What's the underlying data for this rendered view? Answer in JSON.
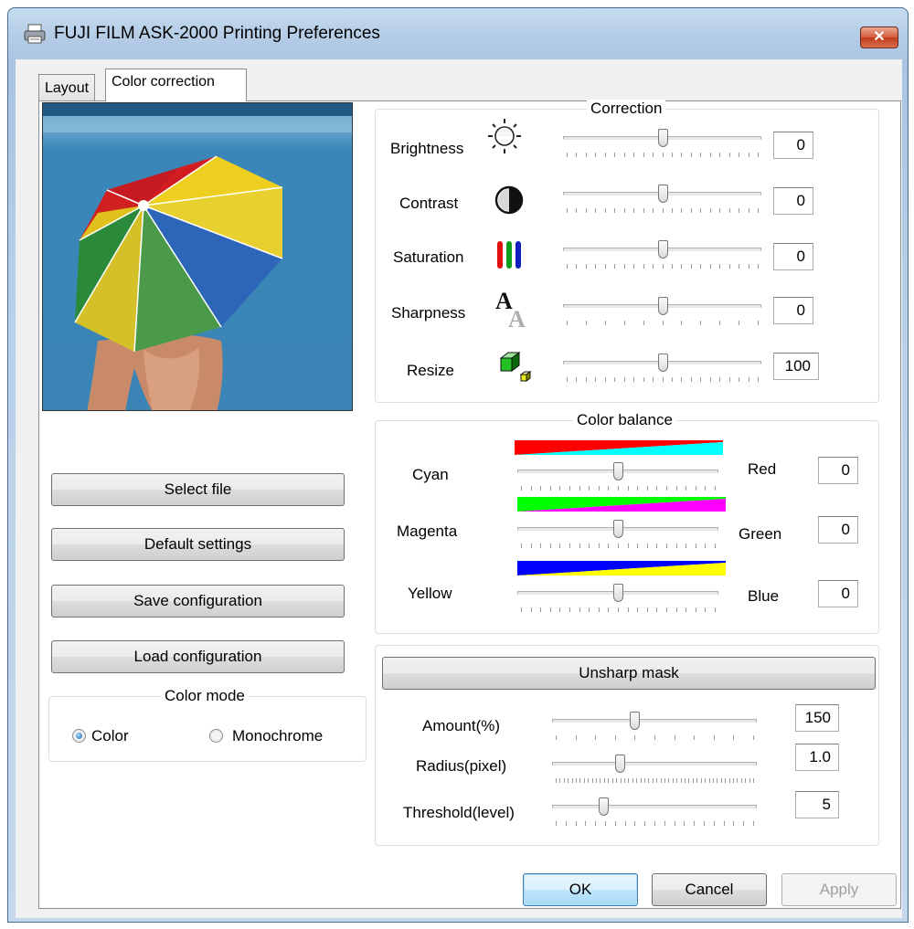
{
  "window": {
    "title": "FUJI FILM ASK-2000 Printing Preferences",
    "close_label": "✕"
  },
  "tabs": [
    {
      "label": "Layout",
      "active": false
    },
    {
      "label": "Color correction",
      "active": true
    }
  ],
  "left": {
    "buttons": {
      "select_file": "Select file",
      "default_settings": "Default settings",
      "save_configuration": "Save configuration",
      "load_configuration": "Load configuration"
    },
    "color_mode": {
      "title": "Color mode",
      "options": [
        {
          "label": "Color",
          "selected": true
        },
        {
          "label": "Monochrome",
          "selected": false
        }
      ]
    }
  },
  "correction": {
    "title": "Correction",
    "rows": [
      {
        "label": "Brightness",
        "icon": "brightness-sun-icon",
        "value": "0",
        "level": 0.5,
        "ticks": 21
      },
      {
        "label": "Contrast",
        "icon": "contrast-half-circle-icon",
        "value": "0",
        "level": 0.5,
        "ticks": 21
      },
      {
        "label": "Saturation",
        "icon": "saturation-rgb-bars-icon",
        "value": "0",
        "level": 0.5,
        "ticks": 21
      },
      {
        "label": "Sharpness",
        "icon": "sharpness-letter-a-icon",
        "value": "0",
        "level": 0.5,
        "ticks": 11
      },
      {
        "label": "Resize",
        "icon": "resize-cubes-icon",
        "value": "100",
        "level": 0.5,
        "ticks": 21
      }
    ]
  },
  "color_balance": {
    "title": "Color balance",
    "rows": [
      {
        "left": "Cyan",
        "right": "Red",
        "value": "0",
        "level": 0.5,
        "from_color": "#00ffff",
        "to_color": "#ff0000",
        "ticks": 21
      },
      {
        "left": "Magenta",
        "right": "Green",
        "value": "0",
        "level": 0.5,
        "from_color": "#ff00ff",
        "to_color": "#00ff00",
        "ticks": 21
      },
      {
        "left": "Yellow",
        "right": "Blue",
        "value": "0",
        "level": 0.5,
        "from_color": "#ffff00",
        "to_color": "#0000ff",
        "ticks": 21
      }
    ]
  },
  "unsharp": {
    "button": "Unsharp mask",
    "rows": [
      {
        "label": "Amount(%)",
        "value": "150",
        "level": 0.4,
        "ticks": 11
      },
      {
        "label": "Radius(pixel)",
        "value": "1.0",
        "level": 0.33,
        "ticks": 50
      },
      {
        "label": "Threshold(level)",
        "value": "5",
        "level": 0.25,
        "ticks": 21
      }
    ]
  },
  "footer": {
    "ok": "OK",
    "cancel": "Cancel",
    "apply": "Apply"
  },
  "colors": {
    "window_frame": "#b5cde6",
    "close_button": "#d45a3b",
    "ok_button": "#bee6fd"
  }
}
